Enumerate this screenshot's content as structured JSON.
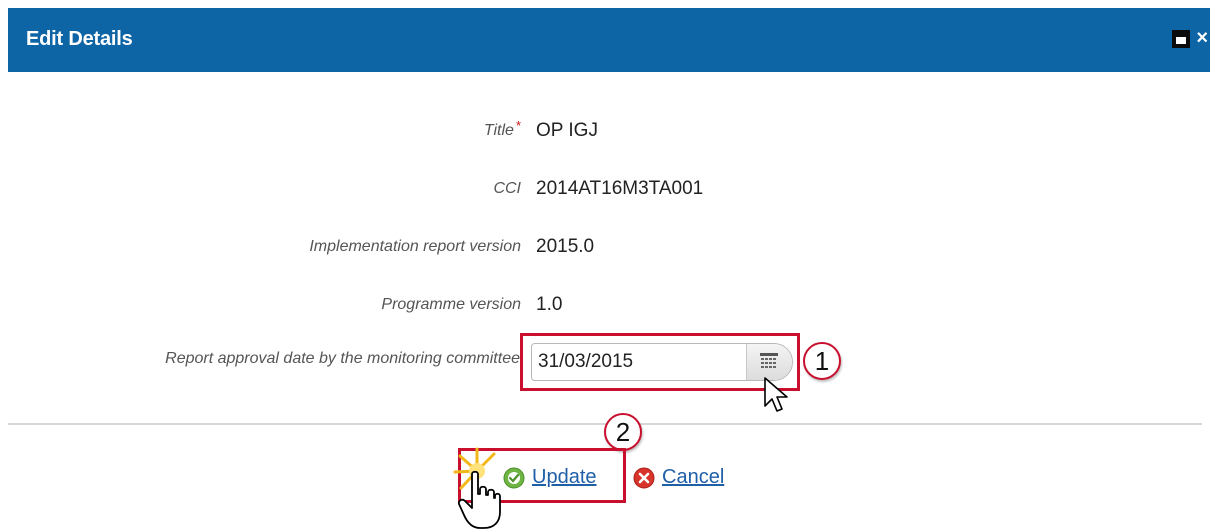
{
  "dialog": {
    "title": "Edit Details",
    "close_glyph": "×"
  },
  "fields": {
    "title_label": "Title",
    "required_mark": "*",
    "title_value": "OP IGJ",
    "cci_label": "CCI",
    "cci_value": "2014AT16M3TA001",
    "impl_label": "Implementation report version",
    "impl_value": "2015.0",
    "prog_label": "Programme version",
    "prog_value": "1.0",
    "approval_label": "Report approval date by the monitoring committee",
    "approval_value": "31/03/2015"
  },
  "callouts": {
    "one": "1",
    "two": "2"
  },
  "actions": {
    "update_label": "Update",
    "cancel_label": "Cancel"
  },
  "colors": {
    "header": "#0e65a5",
    "highlight": "#c8102e",
    "link": "#1f5fa8"
  },
  "icons": {
    "maximize": "maximize-icon",
    "close": "close-icon",
    "calendar": "calendar-icon",
    "update": "check-icon",
    "cancel": "cancel-x-icon",
    "pointer": "arrow-cursor-icon",
    "hand": "hand-cursor-icon"
  }
}
